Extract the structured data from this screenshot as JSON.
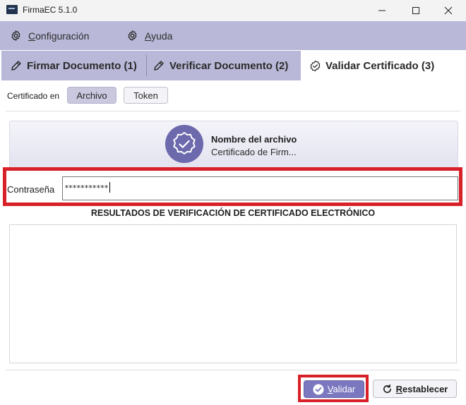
{
  "window": {
    "title": "FirmaEC 5.1.0",
    "icon": "app-icon",
    "controls": [
      "minimize-icon",
      "maximize-icon",
      "close-icon"
    ]
  },
  "menu": {
    "configuracion": "Configuración",
    "ayuda": "Ayuda"
  },
  "tabs": [
    {
      "label": "Firmar Documento (1)",
      "icon": "pen-icon",
      "active": false
    },
    {
      "label": "Verificar Documento (2)",
      "icon": "pen-icon",
      "active": false
    },
    {
      "label": "Validar Certificado (3)",
      "icon": "badge-check-icon",
      "active": true
    }
  ],
  "certificate": {
    "source_label": "Certificado en",
    "options": [
      "Archivo",
      "Token"
    ],
    "selected": "Archivo"
  },
  "file": {
    "title": "Nombre del archivo",
    "subtitle": "Certificado de Firm..."
  },
  "password": {
    "label": "Contraseña",
    "value": "***********"
  },
  "results": {
    "title": "RESULTADOS DE VERIFICACIÓN DE CERTIFICADO ELECTRÓNICO"
  },
  "actions": {
    "validar": "Validar",
    "restablecer": "Restablecer"
  },
  "colors": {
    "menu_bg": "#b9b8d8",
    "accent": "#7b78bf",
    "badge": "#6c69ad",
    "highlight": "#d72027"
  }
}
